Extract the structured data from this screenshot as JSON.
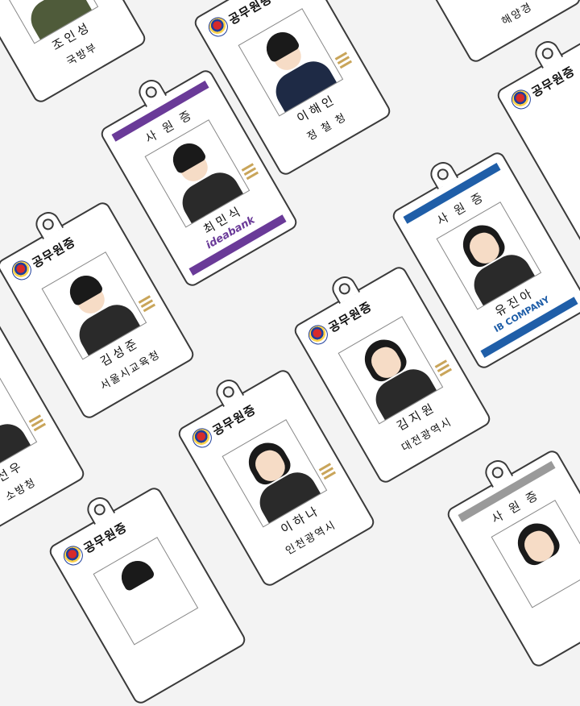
{
  "cards": [
    {
      "kind": "gov",
      "emblem_text": "공무원증",
      "name": "이해인",
      "org": "정 철 청"
    },
    {
      "kind": "staff",
      "heading": "사 원 증",
      "name": "최민식",
      "logo": "ideabank",
      "bar_color": "#6a3a98"
    },
    {
      "kind": "gov",
      "emblem_text": "공무원증",
      "name": "김성준",
      "org": "서울시교육청"
    },
    {
      "kind": "staff",
      "heading": "사 원 증",
      "name": "유진아",
      "logo": "IB COMPANY",
      "bar_color": "#1f5ea8"
    },
    {
      "kind": "gov",
      "emblem_text": "공무원증",
      "name": "김지원",
      "org": "대전광역시"
    },
    {
      "kind": "gov",
      "emblem_text": "공무원증",
      "name": "이하나",
      "org": "인천광역시"
    },
    {
      "kind": "gov",
      "emblem_text": "",
      "name": "조인성",
      "org": "국방부"
    },
    {
      "kind": "gov",
      "emblem_text": "",
      "name": "선우",
      "org": "소방청"
    },
    {
      "kind": "staff",
      "heading": "사 원 증",
      "name": "",
      "logo": "",
      "bar_color": "#9a9a9a"
    },
    {
      "kind": "gov",
      "emblem_text": "공무원증",
      "name": "",
      "org": ""
    },
    {
      "kind": "gov",
      "emblem_text": "",
      "name": "",
      "org": "해양경"
    }
  ]
}
